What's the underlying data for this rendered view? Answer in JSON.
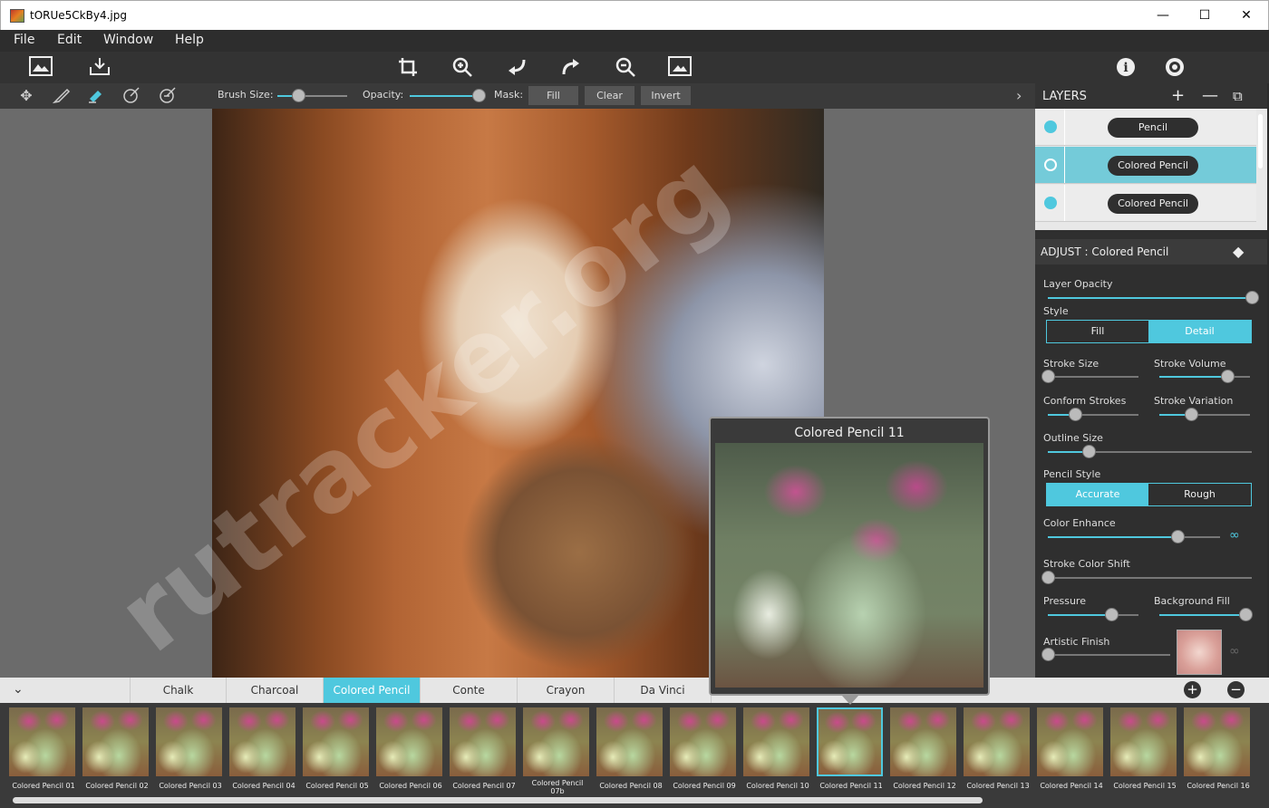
{
  "window": {
    "title": "tORUe5CkBy4.jpg",
    "minimize": "—",
    "maximize": "☐",
    "close": "✕"
  },
  "menu": [
    "File",
    "Edit",
    "Window",
    "Help"
  ],
  "toolbar": {
    "left": [
      "image-open-icon",
      "save-icon"
    ],
    "center": [
      "crop-icon",
      "zoom-in-icon",
      "undo-icon",
      "redo-icon",
      "zoom-out-icon",
      "fit-image-icon"
    ],
    "right": [
      "info-icon",
      "settings-icon"
    ]
  },
  "subtoolbar": {
    "brush_size_label": "Brush Size:",
    "brush_size": 0.3,
    "opacity_label": "Opacity:",
    "opacity": 1.0,
    "mask_label": "Mask:",
    "fill": "Fill",
    "clear": "Clear",
    "invert": "Invert"
  },
  "watermark_text": "rutracker.org",
  "preview": {
    "title": "Colored Pencil 11"
  },
  "layers": {
    "title": "LAYERS",
    "add": "+",
    "remove": "—",
    "duplicate": "⧉",
    "items": [
      {
        "name": "Pencil",
        "selected": false
      },
      {
        "name": "Colored Pencil",
        "selected": true
      },
      {
        "name": "Colored Pencil",
        "selected": false
      }
    ]
  },
  "adjust": {
    "title": "ADJUST : Colored Pencil",
    "layer_opacity": {
      "label": "Layer Opacity",
      "value": 1.0
    },
    "style": {
      "label": "Style",
      "options": [
        "Fill",
        "Detail"
      ],
      "selected": "Detail"
    },
    "stroke_size": {
      "label": "Stroke Size",
      "value": 0.0
    },
    "stroke_volume": {
      "label": "Stroke Volume",
      "value": 0.75
    },
    "conform_strokes": {
      "label": "Conform Strokes",
      "value": 0.3
    },
    "stroke_variation": {
      "label": "Stroke Variation",
      "value": 0.35
    },
    "outline_size": {
      "label": "Outline Size",
      "value": 0.2
    },
    "pencil_style": {
      "label": "Pencil Style",
      "options": [
        "Accurate",
        "Rough"
      ],
      "selected": "Accurate"
    },
    "color_enhance": {
      "label": "Color Enhance",
      "value": 0.75
    },
    "stroke_color_shift": {
      "label": "Stroke Color Shift",
      "value": 0.0
    },
    "pressure": {
      "label": "Pressure",
      "value": 0.7
    },
    "background_fill": {
      "label": "Background Fill",
      "value": 0.95
    },
    "artistic_finish": {
      "label": "Artistic Finish",
      "value": 0.0
    }
  },
  "categories": {
    "tabs": [
      "Chalk",
      "Charcoal",
      "Colored Pencil",
      "Conte",
      "Crayon",
      "Da Vinci"
    ],
    "selected": "Colored Pencil",
    "add": "+",
    "remove": "−"
  },
  "filmstrip": {
    "selected": "Colored Pencil 11",
    "items": [
      "Colored Pencil 01",
      "Colored Pencil 02",
      "Colored Pencil 03",
      "Colored Pencil 04",
      "Colored Pencil 05",
      "Colored Pencil 06",
      "Colored Pencil 07",
      "Colored Pencil 07b",
      "Colored Pencil 08",
      "Colored Pencil 09",
      "Colored Pencil 10",
      "Colored Pencil 11",
      "Colored Pencil 12",
      "Colored Pencil 13",
      "Colored Pencil 14",
      "Colored Pencil 15",
      "Colored Pencil 16"
    ]
  },
  "colors": {
    "accent": "#4fc8de",
    "panel": "#2f2f2f",
    "canvas_bg": "#6b6b6b"
  }
}
